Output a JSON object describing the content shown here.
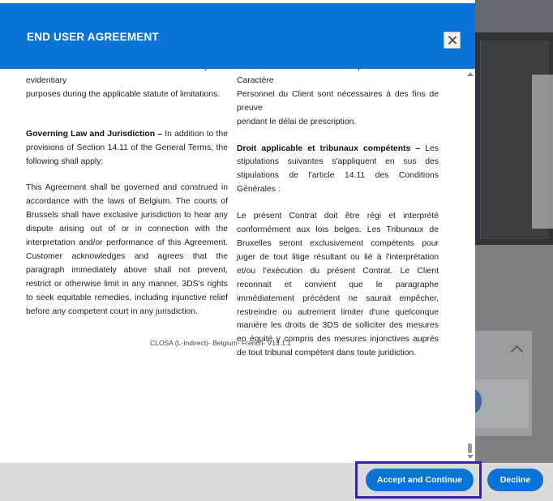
{
  "dialog": {
    "title": "END USER AGREEMENT",
    "close_icon": "close-icon"
  },
  "english": {
    "p1_line1": "retention of Personal Data is necessary for evidentiary",
    "p1_line2": "purposes during the applicable statute of limitations.",
    "heading": "Governing Law and Jurisdiction –",
    "heading_rest": " In addition to the provisions of Section 14.11 of the General Terms, the following shall apply:",
    "body": "This Agreement shall be governed and construed in accordance with the laws of Belgium. The courts of Brussels shall have exclusive jurisdiction to hear any dispute arising out of or in connection with the interpretation and/or performance of this Agreement. Customer acknowledges and agrees that the paragraph immediately above shall not prevent, restrict or otherwise limit in any manner, 3DS's rights to seek equitable remedies, including injunctive relief before any competent court in any jurisdiction."
  },
  "french": {
    "p1_line1": "Caractère Personnel ou lorsque les Données à Caractère",
    "p1_line2": "Personnel du Client sont nécessaires à des fins de preuve",
    "p1_line3": "pendant le délai de prescription.",
    "heading": "Droit applicable et tribunaux compétents –",
    "heading_rest": " Les stipulations suivantes s'appliquent en sus des stipulations de l'article 14.11 des Conditions Générales :",
    "body": "Le présent Contrat doit être régi et interprété conformément aux lois belges. Les Tribunaux de Bruxelles seront exclusivement compétents pour juger de tout litige résultant ou lié à l'interprétation et/ou l'exécution du présent Contrat. Le Client reconnait et convient que le paragraphe immédiatement précédent ne saurait empêcher, restreindre ou autrement limiter d'une quelconque manière les droits de 3DS de solliciter des mesures en équité y compris des mesures injonctives auprès de tout tribunal compétent dans toute juridiction."
  },
  "footer_note": "CLOSA (L-Indirect)- Belgium- French- V13.1.1",
  "actions": {
    "accept_label": "Accept and Continue",
    "decline_label": "Decline"
  },
  "colors": {
    "header": "#0a73d8",
    "button": "#0a73d8",
    "highlight": "#3a21a8",
    "action_bar": "#dadada"
  }
}
